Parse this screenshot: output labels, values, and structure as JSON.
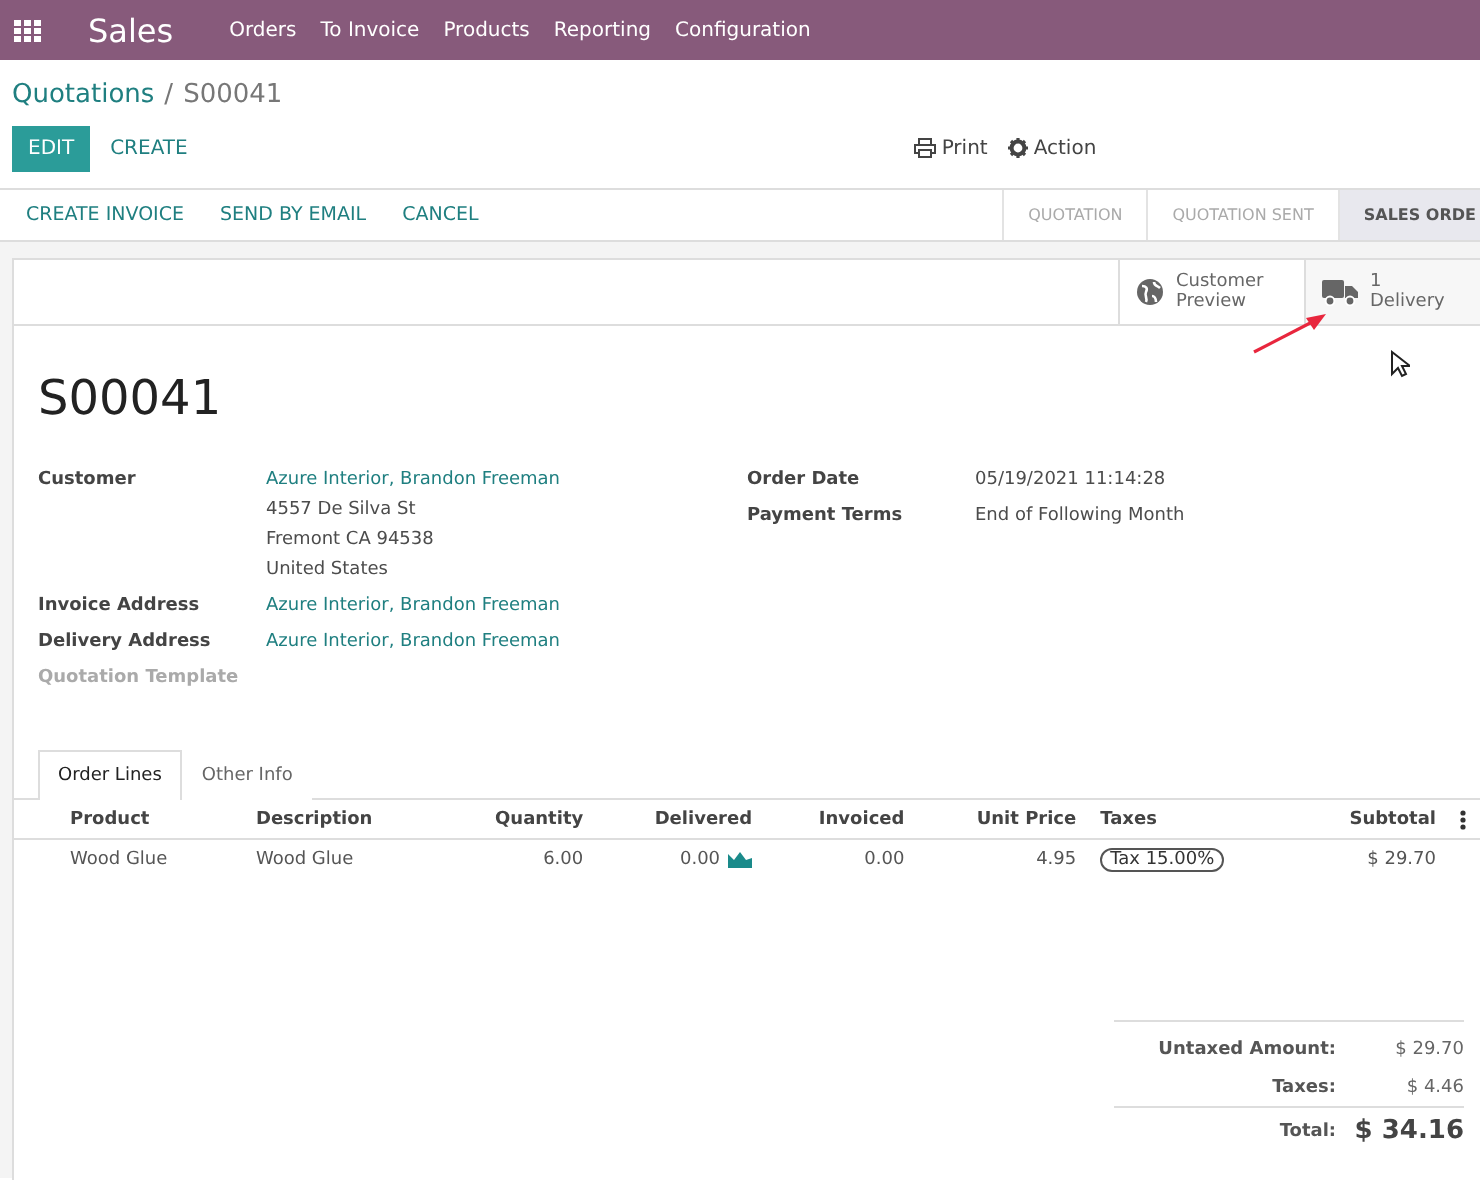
{
  "navbar": {
    "app": "Sales",
    "menu": [
      "Orders",
      "To Invoice",
      "Products",
      "Reporting",
      "Configuration"
    ]
  },
  "breadcrumb": {
    "parent": "Quotations",
    "separator": "/",
    "current": "S00041"
  },
  "control_buttons": [
    {
      "label": "EDIT",
      "kind": "primary"
    },
    {
      "label": "CREATE",
      "kind": "link"
    }
  ],
  "sidebar_actions": [
    {
      "label": "Print",
      "kind": "print"
    },
    {
      "label": "Action",
      "kind": "gear"
    }
  ],
  "header_buttons": [
    "CREATE INVOICE",
    "SEND BY EMAIL",
    "CANCEL"
  ],
  "stages": [
    {
      "label": "QUOTATION",
      "selected": false
    },
    {
      "label": "QUOTATION SENT",
      "selected": false
    },
    {
      "label": "SALES ORDE",
      "selected": true
    }
  ],
  "smart_buttons": [
    {
      "kind": "globe",
      "lines": [
        "Customer",
        "Preview"
      ]
    },
    {
      "kind": "truck",
      "lines": [
        "1",
        "Delivery"
      ]
    }
  ],
  "title": "S00041",
  "left_fields": [
    {
      "label": "Customer",
      "link": "Azure Interior, Brandon Freeman",
      "lines": [
        "4557 De Silva St",
        "Fremont CA 94538",
        "United States"
      ]
    },
    {
      "label": "Invoice Address",
      "link": "Azure Interior, Brandon Freeman"
    },
    {
      "label": "Delivery Address",
      "link": "Azure Interior, Brandon Freeman"
    },
    {
      "label": "Quotation Template",
      "disabled": true
    }
  ],
  "right_fields": [
    {
      "label": "Order Date",
      "value": "05/19/2021 11:14:28"
    },
    {
      "label": "Payment Terms",
      "value": "End of Following Month"
    }
  ],
  "tabs": [
    {
      "label": "Order Lines",
      "selected": true
    },
    {
      "label": "Other Info",
      "selected": false
    }
  ],
  "table": {
    "columns": [
      "Product",
      "Description",
      "Quantity",
      "Delivered",
      "Invoiced",
      "Unit Price",
      "Taxes",
      "Subtotal"
    ],
    "rows": [
      {
        "product": "Wood Glue",
        "description": "Wood Glue",
        "quantity": "6.00",
        "delivered": "0.00",
        "invoiced": "0.00",
        "unit_price": "4.95",
        "taxes": "Tax 15.00%",
        "subtotal": "$ 29.70"
      }
    ]
  },
  "totals": [
    {
      "label": "Untaxed Amount:",
      "value": "$ 29.70",
      "kind": "sub"
    },
    {
      "label": "Taxes:",
      "value": "$ 4.46",
      "kind": "sub"
    },
    {
      "label": "Total:",
      "value": "$ 34.16",
      "kind": "total"
    }
  ]
}
